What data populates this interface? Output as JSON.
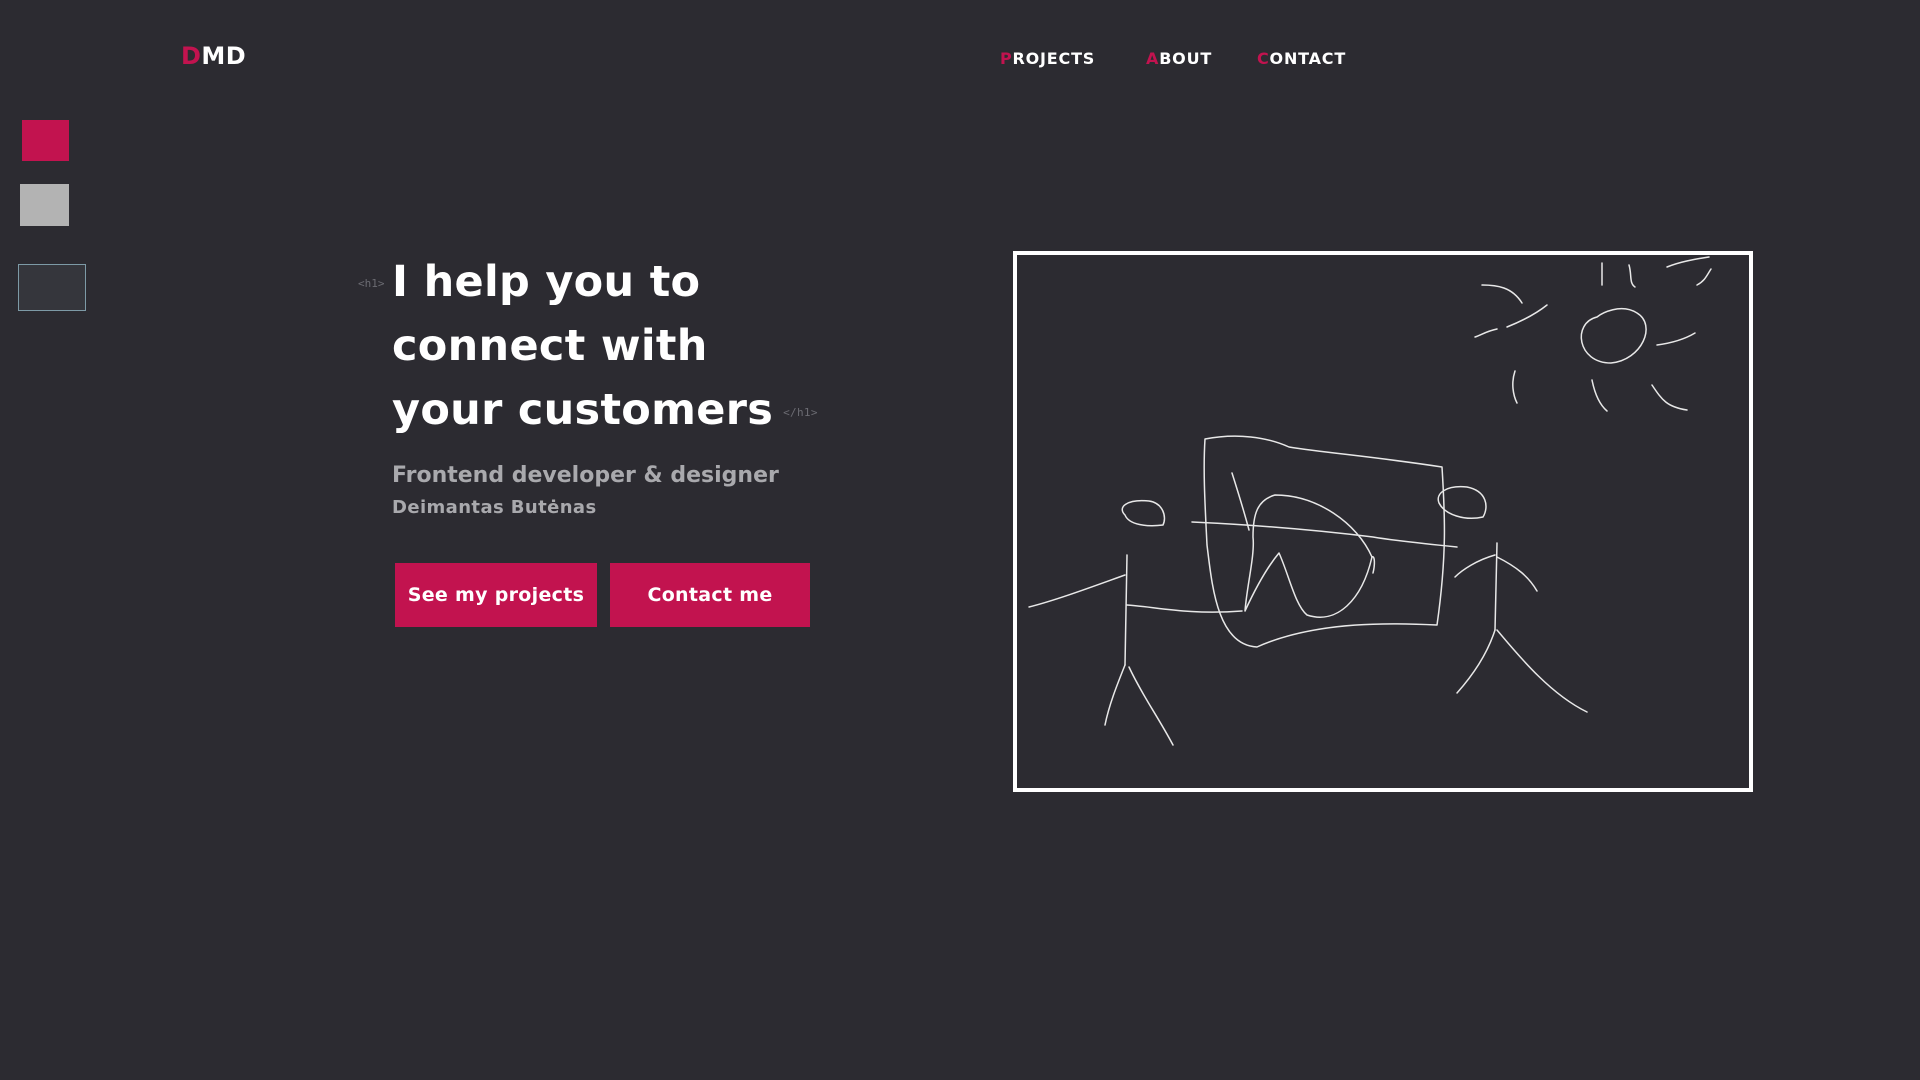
{
  "logo": {
    "first_letter": "D",
    "rest": "MD"
  },
  "nav": [
    {
      "first": "P",
      "rest": "ROJECTS"
    },
    {
      "first": "A",
      "rest": "BOUT"
    },
    {
      "first": "C",
      "rest": "ONTACT"
    }
  ],
  "theme_swatches": [
    "#c2134f",
    "#b3b3b3",
    "#35363c"
  ],
  "hero": {
    "tag_open": "<h1>",
    "headline_lines": [
      "I help you to",
      "connect with",
      "your customers"
    ],
    "tag_close": "</h1>",
    "subtitle": "Frontend developer & designer",
    "author": "Deimantas Butėnas"
  },
  "buttons": {
    "projects": "See my projects",
    "contact": "Contact me"
  },
  "illustration": {
    "icon": "hand-drawn-sketch-illustration"
  },
  "colors": {
    "background": "#2c2b31",
    "accent": "#c2134f",
    "text": "#ffffff",
    "muted": "#a9a9ad"
  }
}
